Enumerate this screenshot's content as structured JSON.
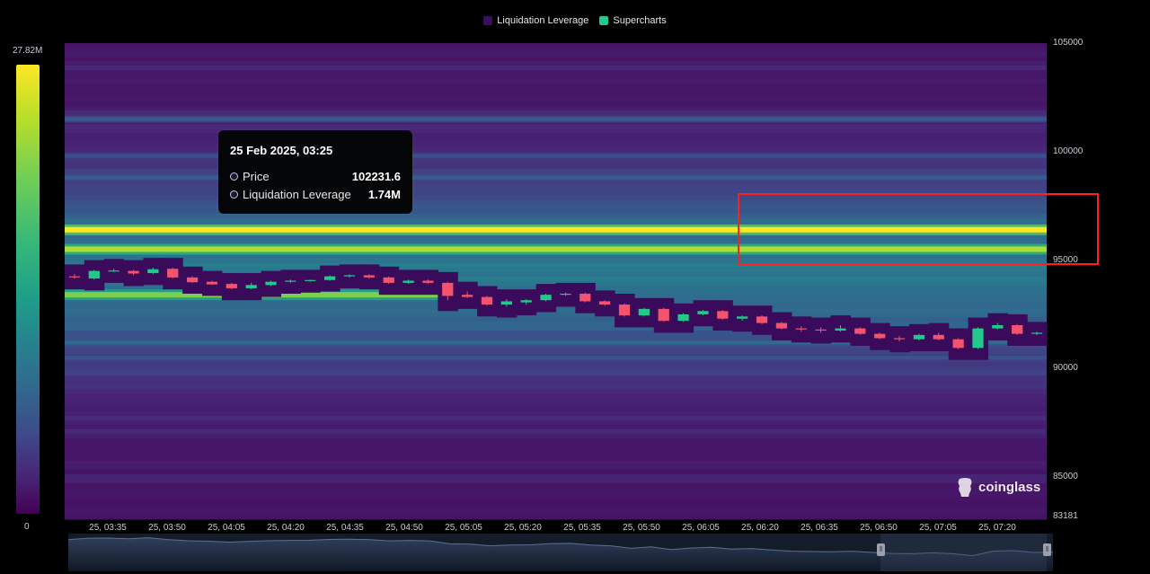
{
  "legend": [
    {
      "label": "Liquidation Leverage",
      "color": "#3b0f5c"
    },
    {
      "label": "Supercharts",
      "color": "#22c98a"
    }
  ],
  "colorscale": {
    "max_label": "27.82M",
    "min_label": "0"
  },
  "tooltip": {
    "date": "25 Feb 2025, 03:25",
    "rows": [
      {
        "label": "Price",
        "value": "102231.6"
      },
      {
        "label": "Liquidation Leverage",
        "value": "1.74M"
      }
    ]
  },
  "watermark": "coinglass",
  "chart_data": {
    "type": "heatmap",
    "x_tick_labels": [
      "25, 03:35",
      "25, 03:50",
      "25, 04:05",
      "25, 04:20",
      "25, 04:35",
      "25, 04:50",
      "25, 05:05",
      "25, 05:20",
      "25, 05:35",
      "25, 05:50",
      "25, 06:05",
      "25, 06:20",
      "25, 06:35",
      "25, 06:50",
      "25, 07:05",
      "25, 07:20"
    ],
    "y_ticks": [
      105000,
      100000,
      95000,
      90000,
      85000,
      83181
    ],
    "ylim": [
      83181,
      105000
    ],
    "colorscale_range": [
      0,
      27.82
    ],
    "colorscale_unit": "M",
    "liquidation_bands": [
      {
        "price": 96400,
        "intensity": 1.0
      },
      {
        "price": 95500,
        "intensity": 0.88
      },
      {
        "price": 93400,
        "intensity": 0.8,
        "end_candle": 18
      },
      {
        "price": 101500,
        "intensity": 0.28
      },
      {
        "price": 98800,
        "intensity": 0.3
      },
      {
        "price": 99800,
        "intensity": 0.24
      },
      {
        "price": 91200,
        "intensity": 0.34
      },
      {
        "price": 90500,
        "intensity": 0.26
      }
    ],
    "candles": [
      {
        "o": 94250,
        "h": 94350,
        "l": 94150,
        "c": 94200
      },
      {
        "o": 94150,
        "h": 94550,
        "l": 94100,
        "c": 94500
      },
      {
        "o": 94500,
        "h": 94600,
        "l": 94450,
        "c": 94520
      },
      {
        "o": 94500,
        "h": 94550,
        "l": 94300,
        "c": 94380
      },
      {
        "o": 94400,
        "h": 94650,
        "l": 94350,
        "c": 94580
      },
      {
        "o": 94600,
        "h": 94650,
        "l": 94150,
        "c": 94200
      },
      {
        "o": 94200,
        "h": 94250,
        "l": 93950,
        "c": 93980
      },
      {
        "o": 94000,
        "h": 94050,
        "l": 93850,
        "c": 93880
      },
      {
        "o": 93900,
        "h": 93950,
        "l": 93650,
        "c": 93700
      },
      {
        "o": 93700,
        "h": 93950,
        "l": 93650,
        "c": 93850
      },
      {
        "o": 93850,
        "h": 94050,
        "l": 93800,
        "c": 94000
      },
      {
        "o": 94000,
        "h": 94100,
        "l": 93950,
        "c": 94050
      },
      {
        "o": 94050,
        "h": 94100,
        "l": 94000,
        "c": 94080
      },
      {
        "o": 94080,
        "h": 94300,
        "l": 94050,
        "c": 94250
      },
      {
        "o": 94250,
        "h": 94350,
        "l": 94200,
        "c": 94300
      },
      {
        "o": 94300,
        "h": 94350,
        "l": 94150,
        "c": 94200
      },
      {
        "o": 94200,
        "h": 94250,
        "l": 93900,
        "c": 93950
      },
      {
        "o": 93950,
        "h": 94100,
        "l": 93900,
        "c": 94050
      },
      {
        "o": 94050,
        "h": 94100,
        "l": 93900,
        "c": 93950
      },
      {
        "o": 93950,
        "h": 94000,
        "l": 93150,
        "c": 93350
      },
      {
        "o": 93400,
        "h": 93550,
        "l": 93250,
        "c": 93300
      },
      {
        "o": 93300,
        "h": 93350,
        "l": 92900,
        "c": 92950
      },
      {
        "o": 92950,
        "h": 93200,
        "l": 92850,
        "c": 93100
      },
      {
        "o": 93050,
        "h": 93200,
        "l": 92950,
        "c": 93150
      },
      {
        "o": 93150,
        "h": 93450,
        "l": 93100,
        "c": 93400
      },
      {
        "o": 93400,
        "h": 93500,
        "l": 93350,
        "c": 93450
      },
      {
        "o": 93450,
        "h": 93500,
        "l": 93050,
        "c": 93100
      },
      {
        "o": 93100,
        "h": 93150,
        "l": 92900,
        "c": 92950
      },
      {
        "o": 92950,
        "h": 93000,
        "l": 92400,
        "c": 92450
      },
      {
        "o": 92450,
        "h": 92800,
        "l": 92400,
        "c": 92750
      },
      {
        "o": 92750,
        "h": 92800,
        "l": 92150,
        "c": 92200
      },
      {
        "o": 92200,
        "h": 92550,
        "l": 92150,
        "c": 92500
      },
      {
        "o": 92500,
        "h": 92700,
        "l": 92450,
        "c": 92650
      },
      {
        "o": 92650,
        "h": 92700,
        "l": 92250,
        "c": 92300
      },
      {
        "o": 92300,
        "h": 92450,
        "l": 92200,
        "c": 92400
      },
      {
        "o": 92400,
        "h": 92450,
        "l": 92050,
        "c": 92100
      },
      {
        "o": 92100,
        "h": 92150,
        "l": 91800,
        "c": 91850
      },
      {
        "o": 91850,
        "h": 91950,
        "l": 91700,
        "c": 91800
      },
      {
        "o": 91800,
        "h": 91900,
        "l": 91650,
        "c": 91750
      },
      {
        "o": 91750,
        "h": 92000,
        "l": 91700,
        "c": 91850
      },
      {
        "o": 91850,
        "h": 91900,
        "l": 91550,
        "c": 91600
      },
      {
        "o": 91600,
        "h": 91650,
        "l": 91350,
        "c": 91400
      },
      {
        "o": 91400,
        "h": 91500,
        "l": 91250,
        "c": 91350
      },
      {
        "o": 91350,
        "h": 91600,
        "l": 91300,
        "c": 91550
      },
      {
        "o": 91550,
        "h": 91650,
        "l": 91300,
        "c": 91350
      },
      {
        "o": 91350,
        "h": 91400,
        "l": 90900,
        "c": 90950
      },
      {
        "o": 90950,
        "h": 91900,
        "l": 90900,
        "c": 91850
      },
      {
        "o": 91850,
        "h": 92100,
        "l": 91800,
        "c": 92000
      },
      {
        "o": 92000,
        "h": 92050,
        "l": 91550,
        "c": 91600
      },
      {
        "o": 91600,
        "h": 91700,
        "l": 91550,
        "c": 91650
      }
    ]
  }
}
